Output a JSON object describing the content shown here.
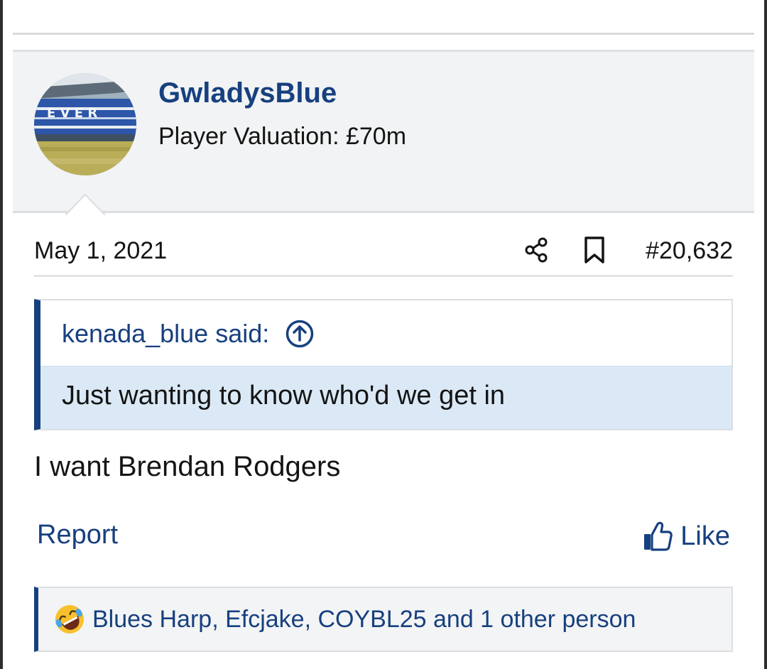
{
  "post": {
    "author": {
      "username": "GwladysBlue",
      "title": "Player Valuation: £70m",
      "avatar": "stadium-avatar"
    },
    "date": "May 1, 2021",
    "number": "#20,632",
    "quote": {
      "author_said": "kenada_blue said:",
      "text": "Just wanting to know who'd we get in"
    },
    "message": "I want Brendan Rodgers",
    "actions": {
      "report": "Report",
      "like": "Like"
    },
    "reactions": {
      "emoji": "rolling-on-floor-laughing",
      "list": "Blues Harp, Efcjake, COYBL25 and 1 other person"
    }
  },
  "icons": {
    "share": "share-icon",
    "bookmark": "bookmark-icon",
    "jump_to_quote": "arrow-up-circle-icon",
    "like": "thumbs-up-icon"
  },
  "colors": {
    "brand_blue": "#17407f",
    "quote_body_bg": "#dbe9f6",
    "header_bg": "#f2f3f4"
  }
}
